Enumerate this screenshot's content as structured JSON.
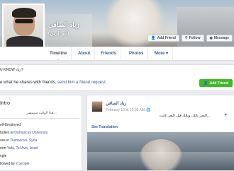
{
  "profile": {
    "name": "زياد الصافي",
    "alt_name": "(أبو الزين)"
  },
  "cover_actions": {
    "add_friend": "Add Friend",
    "follow": "Follow",
    "message": "Message"
  },
  "tabs": [
    {
      "label": "Timeline",
      "active": true
    },
    {
      "label": "About",
      "active": false
    },
    {
      "label": "Friends",
      "active": false
    },
    {
      "label": "Photos",
      "active": false
    },
    {
      "label": "More ▾",
      "active": false
    }
  ],
  "know_box": {
    "heading": "U KNOW زياد?",
    "msg_before": "e what he shares with friends, ",
    "msg_link": "send him a friend request.",
    "add_friend": "Add Friend"
  },
  "intro": {
    "title": "Intro",
    "bio": "هذا الوقت سيمضي...",
    "rows": [
      {
        "text": "elf-Employed",
        "link": ""
      },
      {
        "text": "tudies at ",
        "link": "Damascus University"
      },
      {
        "text": "ves in ",
        "link": "Damascus, Syria"
      },
      {
        "text": "rom ",
        "link": "Yafa, Tel Aviv, Israel"
      },
      {
        "text": "ngle",
        "link": ""
      },
      {
        "text": "llowed by ",
        "link": "2 people"
      }
    ]
  },
  "post": {
    "author": "زياد الصافي",
    "date": "February 16 at 10:05 AM",
    "privacy_icon": "globe-icon",
    "text": "...البحر بالك، وبالك قبل البحر كانت",
    "see_translation": "See Translation"
  },
  "colors": {
    "link": "#385898",
    "green": "#42b72a",
    "background": "#e9ebee"
  }
}
